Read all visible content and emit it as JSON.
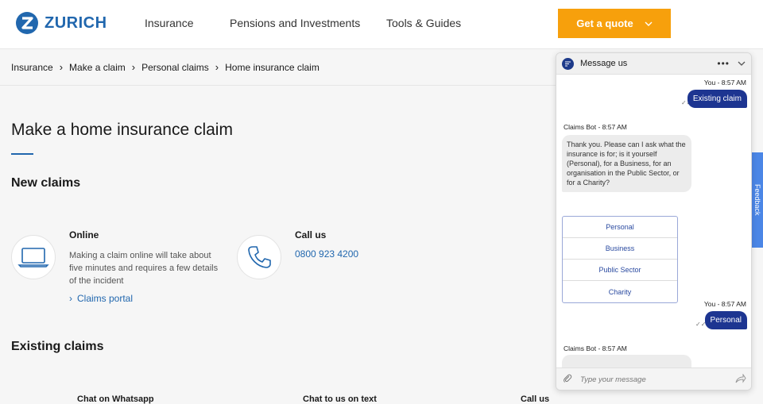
{
  "header": {
    "brand": "ZURICH",
    "nav": [
      "Insurance",
      "Pensions and Investments",
      "Tools & Guides"
    ],
    "cta_label": "Get a quote"
  },
  "breadcrumb": [
    "Insurance",
    "Make a claim",
    "Personal claims",
    "Home insurance claim"
  ],
  "page": {
    "title": "Make a home insurance claim",
    "new_claims_heading": "New claims",
    "existing_claims_heading": "Existing claims",
    "online": {
      "title": "Online",
      "text": "Making a claim online will take about five minutes and requires a few details of the incident",
      "link": "Claims portal"
    },
    "call": {
      "title": "Call us",
      "phone": "0800 923 4200"
    },
    "bottom_labels": [
      "Chat on Whatsapp",
      "Chat to us on text",
      "Call us"
    ]
  },
  "feedback_label": "Feedback",
  "chat": {
    "title": "Message us",
    "messages": [
      {
        "from": "You - 8:57 AM",
        "text": "Existing claim"
      },
      {
        "from": "Claims Bot - 8:57 AM",
        "text": "Thank you. Please can I ask what the insurance is for; is it yourself (Personal), for a Business, for an organisation in the Public Sector, or for a Charity?"
      },
      {
        "from": "You - 8:57 AM",
        "text": "Personal"
      },
      {
        "from": "Claims Bot - 8:57 AM",
        "text": ""
      }
    ],
    "options": [
      "Personal",
      "Business",
      "Public Sector",
      "Charity"
    ],
    "input_placeholder": "Type your message"
  },
  "colors": {
    "brand_blue": "#2167ae",
    "cta_orange": "#f7a00c",
    "chat_bubble": "#1d3591"
  }
}
